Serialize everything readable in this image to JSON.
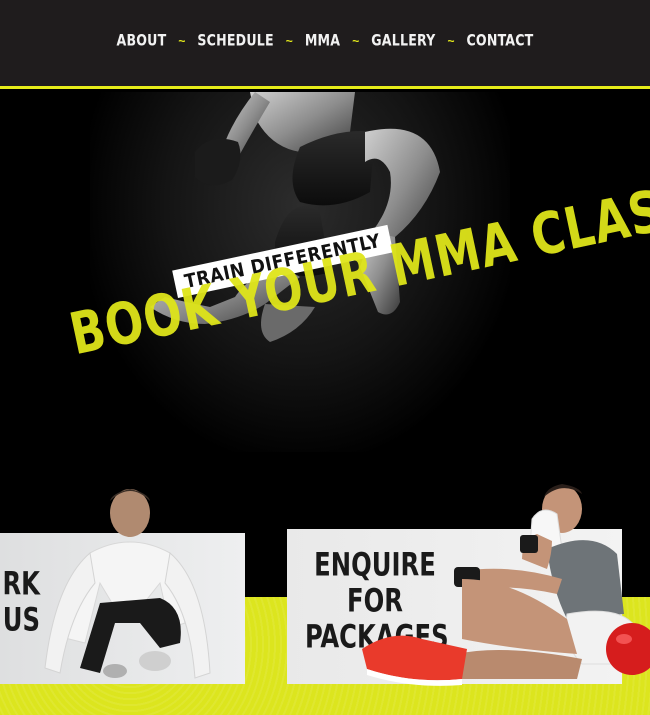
{
  "nav": {
    "items": [
      "ABOUT",
      "SCHEDULE",
      "MMA",
      "GALLERY",
      "CONTACT"
    ],
    "separator": "~"
  },
  "hero": {
    "tagline": "TRAIN DIFFERENTLY",
    "headline": "BOOK YOUR MMA CLASS"
  },
  "cards": {
    "left": {
      "line1": "RK",
      "line2": "US"
    },
    "right": {
      "line1": "ENQUIRE FOR",
      "line2": "PACKAGES"
    }
  },
  "colors": {
    "accent": "#e6ec1a",
    "nav_bg": "#1f1c1d",
    "hero_bg": "#000000"
  }
}
